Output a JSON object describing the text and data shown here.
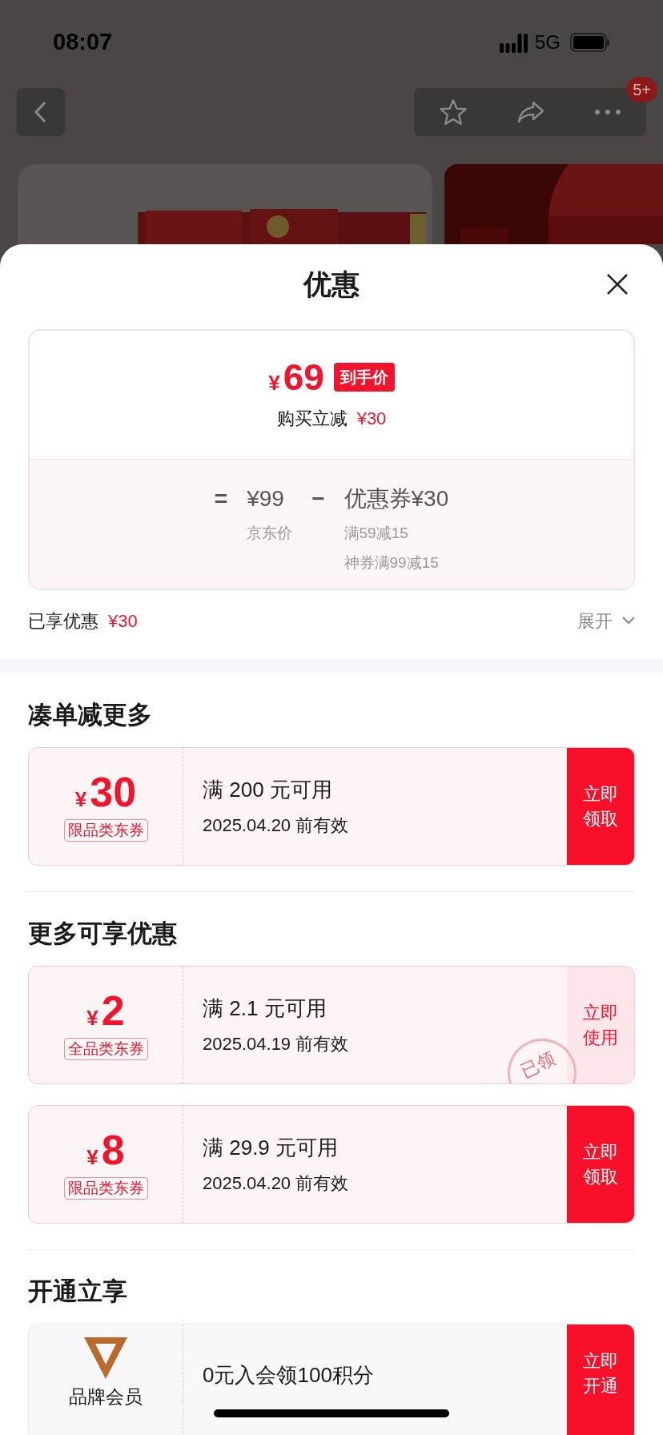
{
  "status_bar": {
    "time": "08:07",
    "network": "5G"
  },
  "nav": {
    "badge": "5+"
  },
  "sheet": {
    "title": "优惠"
  },
  "price_box": {
    "currency": "¥",
    "price": "69",
    "price_tag": "到手价",
    "saving_label": "购买立减",
    "saving_amount": "¥30",
    "equals": "=",
    "base_price": "¥99",
    "base_label": "京东价",
    "minus": "−",
    "coupon_total": "优惠券¥30",
    "coupon_details": [
      "满59减15",
      "神券满99减15"
    ]
  },
  "summary": {
    "label": "已享优惠",
    "amount": "¥30",
    "expand": "展开"
  },
  "sections": [
    {
      "title": "凑单减更多",
      "coupons": [
        {
          "kind": "coupon",
          "currency": "¥",
          "amount": "30",
          "tag": "限品类东券",
          "condition": "满 200 元可用",
          "expiry": "2025.04.20 前有效",
          "button": "立即领取",
          "claimed": false
        }
      ]
    },
    {
      "title": "更多可享优惠",
      "coupons": [
        {
          "kind": "coupon",
          "currency": "¥",
          "amount": "2",
          "tag": "全品类东券",
          "condition": "满 2.1 元可用",
          "expiry": "2025.04.19 前有效",
          "button": "立即使用",
          "claimed": true,
          "stamp": "已领"
        },
        {
          "kind": "coupon",
          "currency": "¥",
          "amount": "8",
          "tag": "限品类东券",
          "condition": "满 29.9 元可用",
          "expiry": "2025.04.20 前有效",
          "button": "立即领取",
          "claimed": false
        }
      ]
    },
    {
      "title": "开通立享",
      "coupons": [
        {
          "kind": "membership",
          "name": "品牌会员",
          "condition": "0元入会领100积分",
          "button": "立即开通",
          "claimed": false
        }
      ]
    }
  ]
}
